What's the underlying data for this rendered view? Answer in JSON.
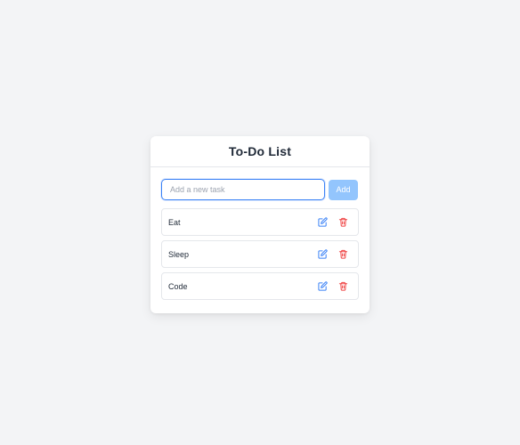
{
  "app": {
    "title": "To-Do List"
  },
  "input": {
    "placeholder": "Add a new task",
    "value": ""
  },
  "add_button": {
    "label": "Add"
  },
  "tasks": [
    {
      "label": "Eat"
    },
    {
      "label": "Sleep"
    },
    {
      "label": "Code"
    }
  ],
  "icons": {
    "edit": "edit-icon",
    "delete": "trash-icon"
  },
  "colors": {
    "accent": "#3b82f6",
    "add_button_bg": "#93c5fd",
    "delete": "#ef4444",
    "background": "#f3f4f6"
  }
}
